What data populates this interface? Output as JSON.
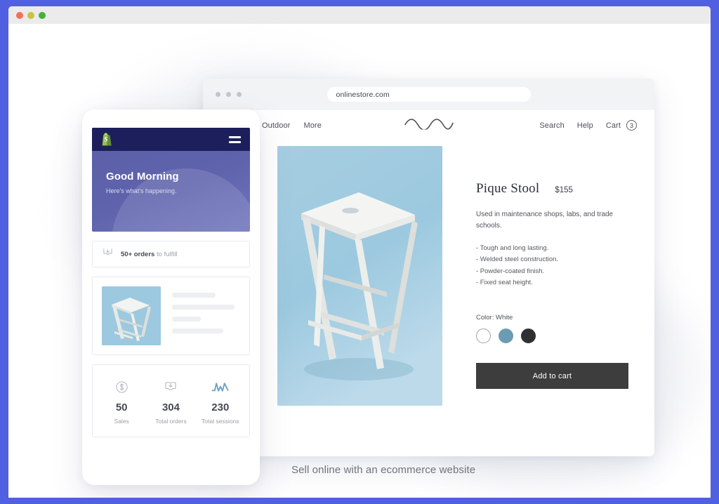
{
  "window": {
    "traffic_lights": [
      "close",
      "minimize",
      "maximize"
    ]
  },
  "browser": {
    "url": "onlinestore.com",
    "dots": 3
  },
  "site_header": {
    "logo_icon": "wave-logo",
    "nav_left": [
      {
        "label": "Outdoor"
      },
      {
        "label": "More"
      }
    ],
    "nav_right": [
      {
        "label": "Search"
      },
      {
        "label": "Help"
      },
      {
        "label": "Cart"
      }
    ],
    "cart_count": "3"
  },
  "product": {
    "image_alt": "white wooden stool on light blue background",
    "title": "Pique Stool",
    "price": "$155",
    "description": "Used in maintenance shops, labs, and trade schools.",
    "features": [
      "- Tough and long lasting.",
      "- Welded steel construction.",
      "- Powder-coated finish.",
      "- Fixed seat height."
    ],
    "color_label": "Color: White",
    "swatches": [
      {
        "name": "white",
        "hex": "#ffffff",
        "selected": true
      },
      {
        "name": "blue",
        "hex": "#6c9cb4",
        "selected": false
      },
      {
        "name": "charcoal",
        "hex": "#2e3033",
        "selected": false
      }
    ],
    "add_to_cart_label": "Add to cart",
    "add_to_cart_color": "#3d3d3d"
  },
  "phone_app": {
    "brand_icon": "shopify-bag-icon",
    "menu_icon": "hamburger-menu-icon",
    "greeting": "Good Morning",
    "greeting_sub": "Here's what's happening.",
    "orders": {
      "icon": "orders-inbox-icon",
      "count_text": "50+ orders",
      "suffix_text": " to fulfill"
    },
    "product_card": {
      "thumb_alt": "white wooden stool thumbnail",
      "skeleton_widths": [
        "64%",
        "92%",
        "42%",
        "75%"
      ]
    },
    "stats": [
      {
        "icon": "dollar-circle-icon",
        "value": "50",
        "label": "Sales"
      },
      {
        "icon": "orders-inbox-icon",
        "value": "304",
        "label": "Total orders"
      },
      {
        "icon": "sessions-chart-icon",
        "value": "230",
        "label": "Total sessions"
      }
    ]
  },
  "caption": "Sell online with an ecommerce website",
  "colors": {
    "page_background": "#5160e0",
    "app_header_purple": "#5b5fa6",
    "app_topbar_navy": "#1d1f5c",
    "sessions_accent": "#6ba3c4"
  }
}
